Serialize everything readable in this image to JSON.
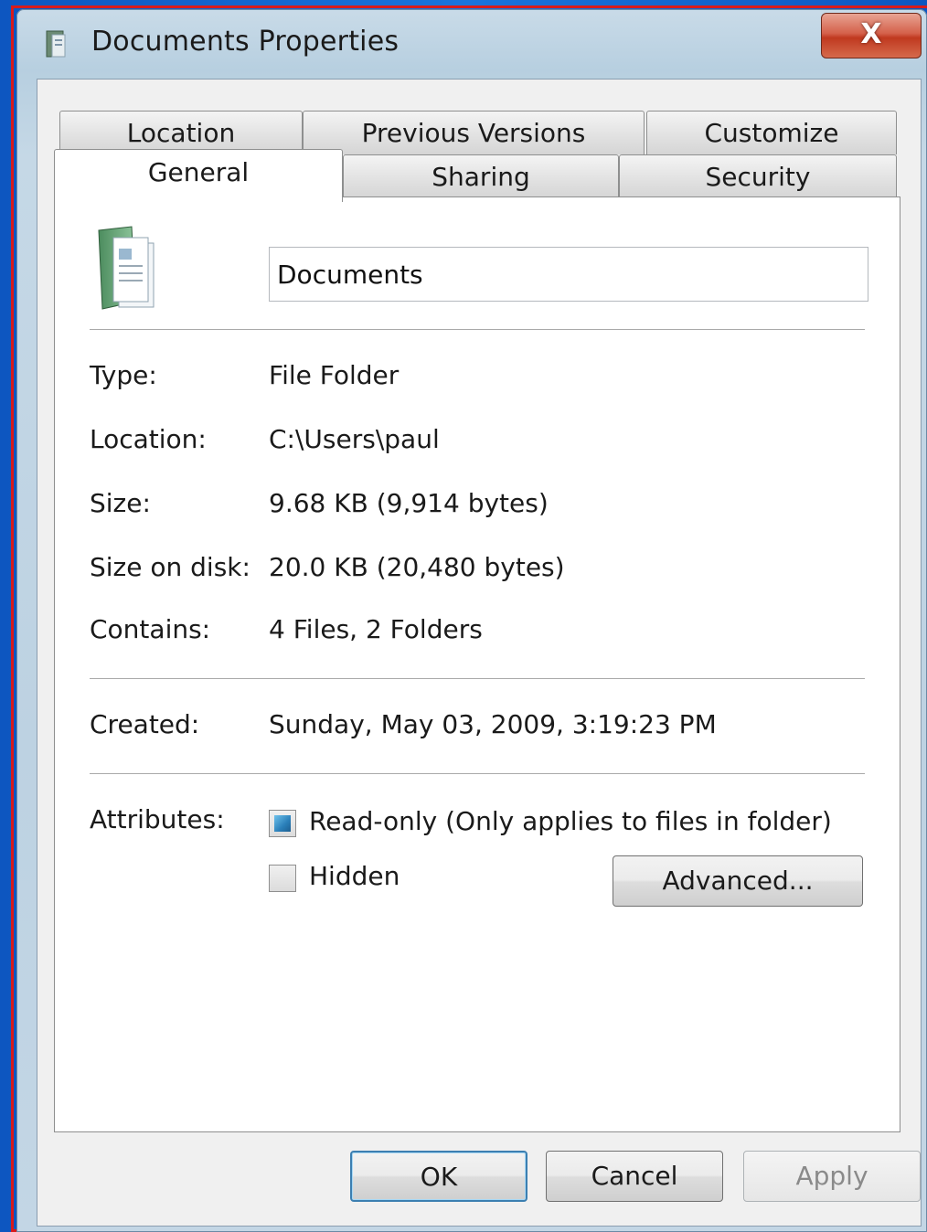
{
  "window": {
    "title": "Documents Properties",
    "close_label": "X"
  },
  "tabs": {
    "row1": [
      "Location",
      "Previous Versions",
      "Customize"
    ],
    "row2": [
      "General",
      "Sharing",
      "Security"
    ],
    "active": "General"
  },
  "general": {
    "folder_name": "Documents",
    "fields": [
      {
        "label": "Type:",
        "value": "File Folder"
      },
      {
        "label": "Location:",
        "value": "C:\\Users\\paul"
      },
      {
        "label": "Size:",
        "value": "9.68 KB (9,914 bytes)"
      },
      {
        "label": "Size on disk:",
        "value": "20.0 KB (20,480 bytes)"
      },
      {
        "label": "Contains:",
        "value": "4 Files, 2 Folders"
      }
    ],
    "created": {
      "label": "Created:",
      "value": "Sunday, May 03, 2009, 3:19:23 PM"
    },
    "attributes": {
      "label": "Attributes:",
      "readonly": {
        "label": "Read-only (Only applies to files in folder)",
        "state": "indeterminate"
      },
      "hidden": {
        "label": "Hidden",
        "checked": false
      },
      "advanced_label": "Advanced..."
    }
  },
  "buttons": {
    "ok": "OK",
    "cancel": "Cancel",
    "apply": "Apply"
  }
}
